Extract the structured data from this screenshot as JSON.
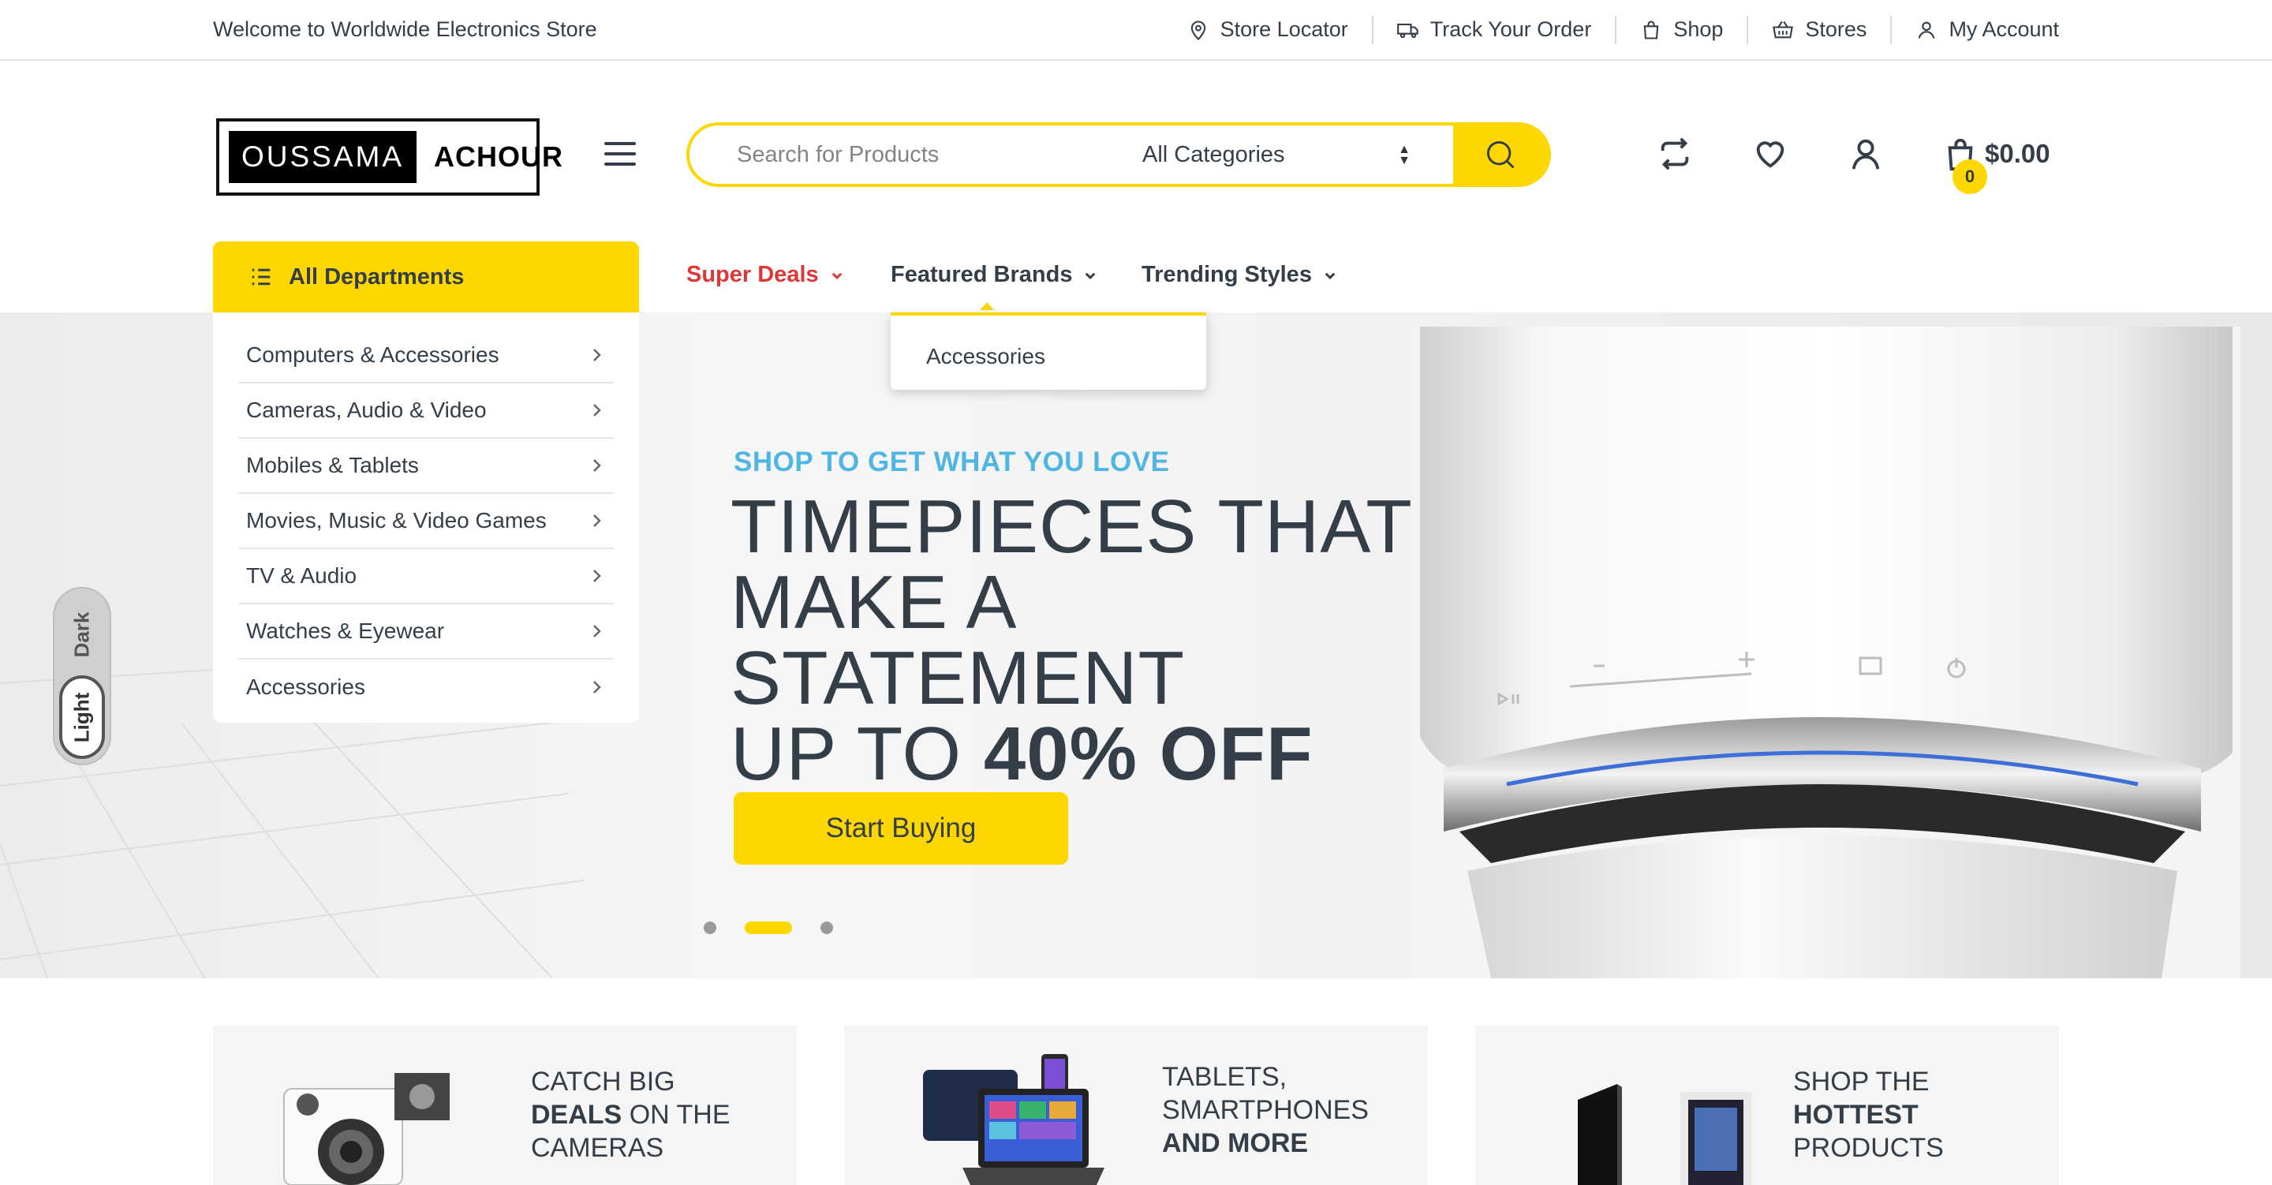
{
  "topbar": {
    "welcome": "Welcome to Worldwide Electronics Store",
    "links": [
      {
        "label": "Store Locator",
        "icon": "location-pin-icon"
      },
      {
        "label": "Track Your Order",
        "icon": "truck-icon"
      },
      {
        "label": "Shop",
        "icon": "shopping-bag-icon"
      },
      {
        "label": "Stores",
        "icon": "basket-icon"
      },
      {
        "label": "My Account",
        "icon": "user-icon"
      }
    ]
  },
  "header": {
    "logo_left": "OUSSAMA",
    "logo_right": "ACHOUR",
    "search": {
      "placeholder": "Search for Products",
      "category": "All Categories"
    },
    "cart": {
      "total": "$0.00",
      "count": "0"
    }
  },
  "nav": {
    "departments_label": "All Departments",
    "items": [
      {
        "label": "Super Deals"
      },
      {
        "label": "Featured Brands"
      },
      {
        "label": "Trending Styles"
      }
    ],
    "dropdown_items": [
      "Accessories"
    ]
  },
  "departments": [
    "Computers & Accessories",
    "Cameras, Audio & Video",
    "Mobiles & Tablets",
    "Movies, Music & Video Games",
    "TV & Audio",
    "Watches & Eyewear",
    "Accessories"
  ],
  "hero": {
    "tag": "SHOP TO GET WHAT YOU LOVE",
    "headline_lines": [
      "TIMEPIECES THAT",
      "MAKE A",
      "STATEMENT"
    ],
    "offer_prefix": "UP TO",
    "offer_value": "40% OFF",
    "button": "Start Buying",
    "slides": 3,
    "active_slide": 2
  },
  "theme_toggle": {
    "dark": "Dark",
    "light": "Light",
    "active": "Light"
  },
  "promos": [
    {
      "line1": "CATCH BIG",
      "bold": "DEALS",
      "rest": "ON THE",
      "line3": "CAMERAS"
    },
    {
      "line1": "TABLETS,",
      "line2": "SMARTPHONES",
      "bold": "AND MORE"
    },
    {
      "line1": "SHOP THE",
      "bold": "HOTTEST",
      "line3": "PRODUCTS"
    }
  ],
  "colors": {
    "accent": "#fed700",
    "text": "#333e48",
    "deals": "#df3737",
    "tag": "#4fb6e3"
  }
}
